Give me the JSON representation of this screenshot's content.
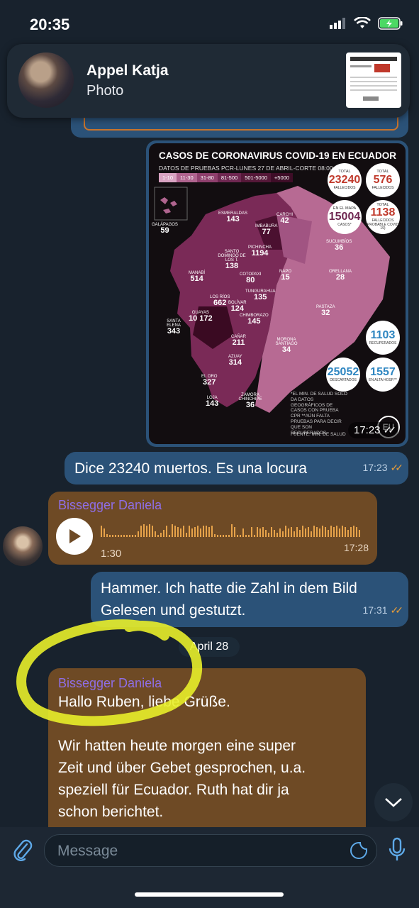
{
  "status": {
    "time": "20:35"
  },
  "notification": {
    "name": "Appel Katja",
    "subtitle": "Photo",
    "thumbnail_icon": "photo-thumbnail"
  },
  "poster": {
    "title": "CASOS DE CORONAVIRUS COVID-19 EN ECUADOR",
    "subtitle": "DATOS DE PRUEBAS PCR-LUNES 27 DE ABRIL-CORTE 08:00",
    "legend": [
      "1-10",
      "11-30",
      "31-80",
      "81-500",
      "501-5000",
      "+5000"
    ],
    "stats": {
      "total_label": "TOTAL",
      "total_cases": "23240",
      "cases_label": "FALLECIDOS",
      "deaths": "576",
      "deaths_label": "FALLECIDOS",
      "map_label": "EN EL MAPA",
      "map_cases": "15004",
      "map_cases_label": "CASOS*",
      "probable": "1138",
      "probable_label": "FALLECIDOS (PROBABLE COVID-19)",
      "recovered": "1103",
      "recovered_label": "RECUPERADOS",
      "discarded": "25052",
      "discarded_label": "DESCARTADOS",
      "hospital": "1557",
      "hospital_label": "EN ALTA HOSP.**"
    },
    "regions": [
      {
        "name": "GALÁPAGOS",
        "value": "59"
      },
      {
        "name": "ESMERALDAS",
        "value": "143"
      },
      {
        "name": "CARCHI",
        "value": "42"
      },
      {
        "name": "IMBABURA",
        "value": "77"
      },
      {
        "name": "SUCUMBÍOS",
        "value": "36"
      },
      {
        "name": "PICHINCHA",
        "value": "1194"
      },
      {
        "name": "SANTO DOMINGO DE LOS T.",
        "value": "138"
      },
      {
        "name": "NAPO",
        "value": "15"
      },
      {
        "name": "ORELLANA",
        "value": "28"
      },
      {
        "name": "MANABÍ",
        "value": "514"
      },
      {
        "name": "COTOPAXI",
        "value": "80"
      },
      {
        "name": "LOS RÍOS",
        "value": "662"
      },
      {
        "name": "TUNGURAHUA",
        "value": "135"
      },
      {
        "name": "BOLÍVAR",
        "value": "124"
      },
      {
        "name": "PASTAZA",
        "value": "32"
      },
      {
        "name": "GUAYAS",
        "value": "10 172"
      },
      {
        "name": "CHIMBORAZO",
        "value": "145"
      },
      {
        "name": "SANTA ELENA",
        "value": "343"
      },
      {
        "name": "CAÑAR",
        "value": "211"
      },
      {
        "name": "MORONA SANTIAGO",
        "value": "34"
      },
      {
        "name": "AZUAY",
        "value": "314"
      },
      {
        "name": "EL ORO",
        "value": "327"
      },
      {
        "name": "LOJA",
        "value": "143"
      },
      {
        "name": "ZAMORA CHINCHIPE",
        "value": "36"
      }
    ],
    "note": "*EL MIN. DE SALUD SOLO DA DATOS GEOGRÁFICOS DE CASOS CON PRUEBA CPR **AÚN FALTA PRUEBAS PARA DECIR QUE SON RECUPERADOS",
    "source": "FUENTE: MIN. DE SALUD",
    "logo": "EU",
    "time": "17:23"
  },
  "messages": {
    "m1_text": "Dice 23240 muertos. Es una locura",
    "m1_time": "17:23",
    "voice_sender": "Bissegger Daniela",
    "voice_duration": "1:30",
    "voice_time": "17:28",
    "m2_line1": "Hammer. Ich hatte die Zahl in dem Bild",
    "m2_line2": "Gelesen und gestutzt.",
    "m2_time": "17:31",
    "date_separator": "April 28",
    "m3_sender": "Bissegger Daniela",
    "m3_line1": "Hallo Ruben, liebe Grüße.",
    "m3_line2": "Wir hatten heute morgen eine super",
    "m3_line3": "Zeit und über Gebet gesprochen, u.a.",
    "m3_line4": "speziell für Ecuador. Ruth hat dir ja",
    "m3_line5": "schon berichtet."
  },
  "composer": {
    "placeholder": "Message"
  },
  "colors": {
    "background": "#18222d",
    "outgoing_bubble": "#2b5278",
    "incoming_bubble": "#6e4a25",
    "sender_name": "#8f6ee6",
    "read_check": "#e39b3a",
    "highlight": "#e8ee2a",
    "accent": "#5ea9e8"
  }
}
